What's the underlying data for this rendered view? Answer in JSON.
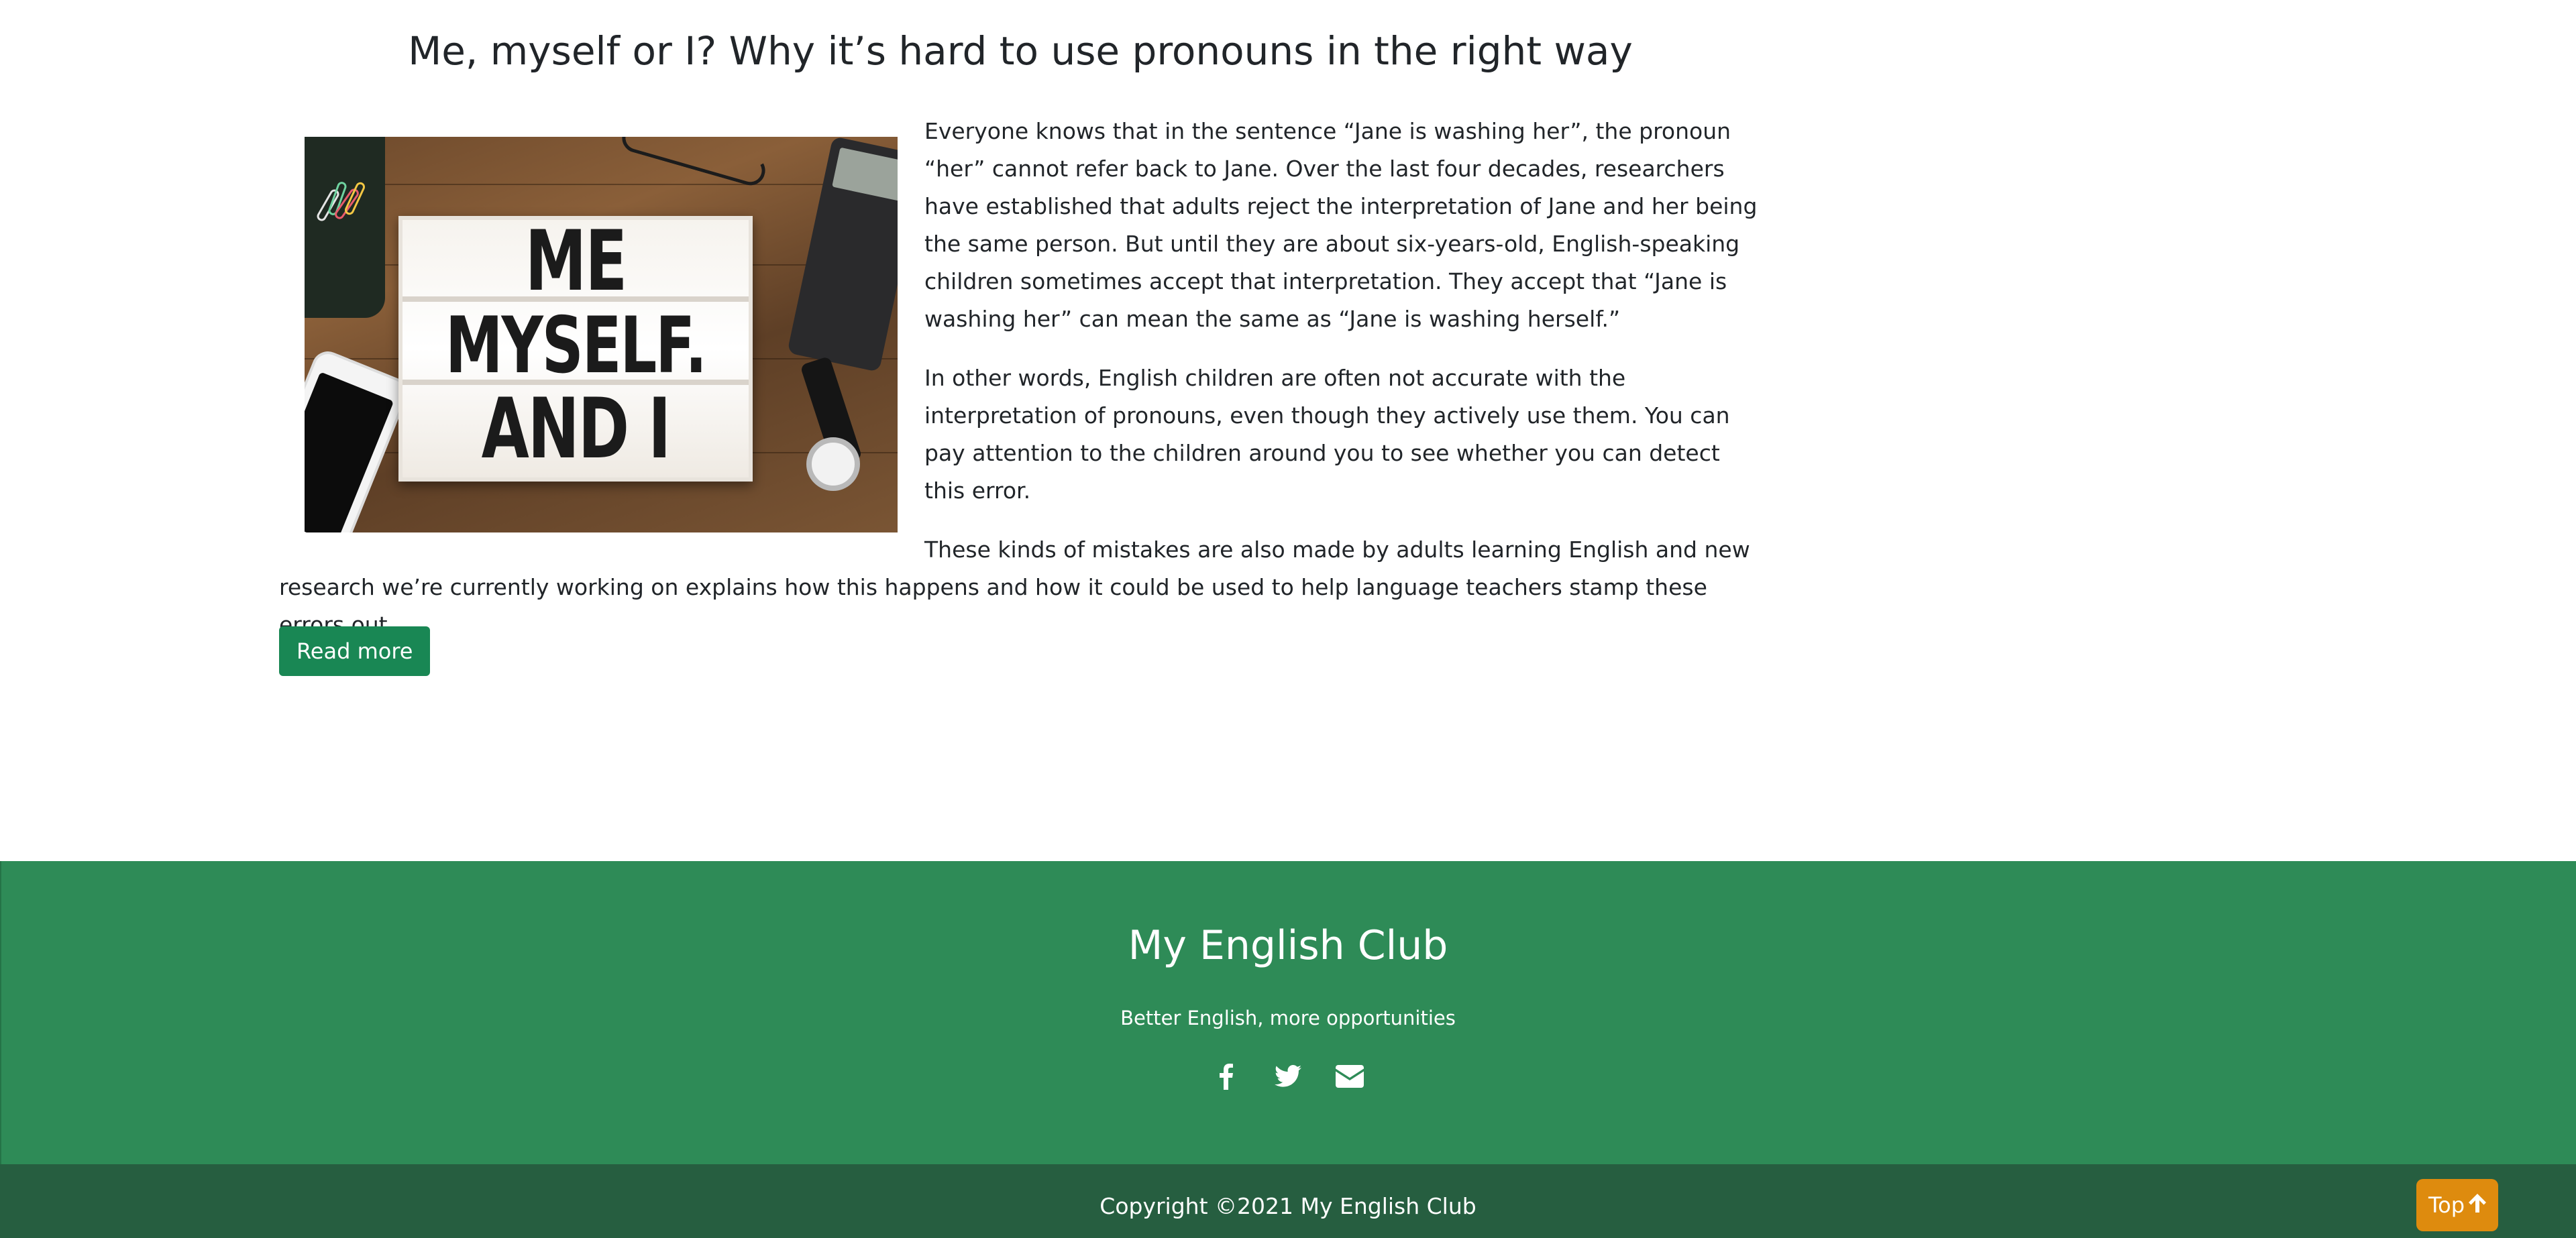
{
  "article": {
    "title": "Me, myself or I? Why it’s hard to use pronouns in the right way",
    "image": {
      "lines": [
        "ME",
        "MYSELF.",
        "AND I"
      ]
    },
    "paragraphs": [
      "Everyone knows that in the sentence “Jane is washing her”, the pronoun “her” cannot refer back to Jane. Over the last four decades, researchers have established that adults reject the interpretation of Jane and her being the same person. But until they are about six-years-old, English-speaking children sometimes accept that interpretation. They accept that “Jane is washing her” can mean the same as “Jane is washing herself.”",
      "In other words, English children are often not accurate with the interpretation of pronouns, even though they actively use them. You can pay attention to the children around you to see whether you can detect this error.",
      "These kinds of mistakes are also made by adults learning English and new research we’re currently working on explains how this happens and how it could be used to help language teachers stamp these errors out…"
    ],
    "read_more_label": "Read more"
  },
  "footer": {
    "site_name": "My English Club",
    "tagline": "Better English, more opportunities",
    "social_icons": [
      "facebook-icon",
      "twitter-icon",
      "envelope-icon"
    ],
    "copyright": "Copyright ©2021 My English Club",
    "top_label": "Top"
  },
  "colors": {
    "primary_green": "#198754",
    "footer_green": "#2e8b57",
    "footer_dark_green": "#265e40",
    "accent_orange": "#de8b0e"
  }
}
